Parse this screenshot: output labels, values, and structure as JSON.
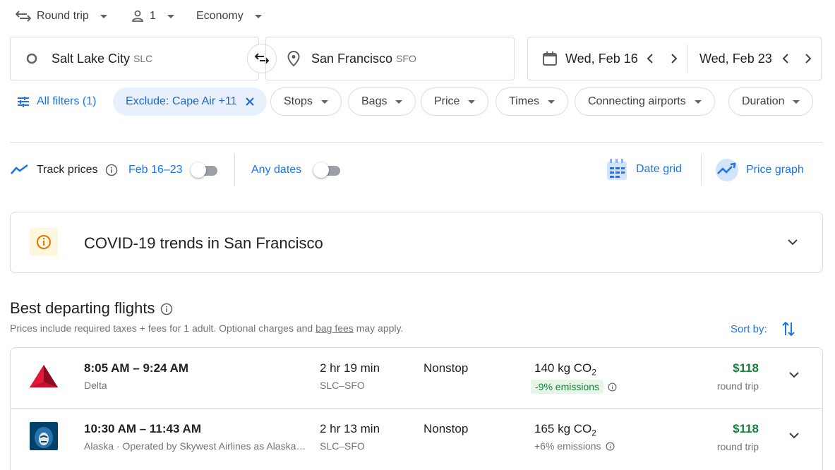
{
  "trip": {
    "type": "Round trip",
    "passengers": "1",
    "cabin": "Economy"
  },
  "search": {
    "origin_city": "Salt Lake City",
    "origin_code": "SLC",
    "dest_city": "San Francisco",
    "dest_code": "SFO",
    "depart_date": "Wed, Feb 16",
    "return_date": "Wed, Feb 23"
  },
  "filters": {
    "all": "All filters (1)",
    "exclude": "Exclude: Cape Air +11",
    "chips": [
      "Stops",
      "Bags",
      "Price",
      "Times",
      "Connecting airports",
      "Duration"
    ]
  },
  "tracking": {
    "track_label": "Track prices",
    "range": "Feb 16–23",
    "any_dates": "Any dates",
    "date_grid": "Date grid",
    "price_graph": "Price graph"
  },
  "covid": {
    "title": "COVID-19 trends in San Francisco"
  },
  "results": {
    "heading": "Best departing flights",
    "note_prefix": "Prices include required taxes + fees for 1 adult. Optional charges and ",
    "note_link": "bag fees",
    "note_suffix": " may apply.",
    "sort_label": "Sort by:"
  },
  "flights": [
    {
      "times": "8:05 AM – 9:24 AM",
      "airline": "Delta",
      "duration": "2 hr 19 min",
      "route": "SLC–SFO",
      "stops": "Nonstop",
      "co2": "140 kg CO",
      "co2_sub": "2",
      "emissions": "-9% emissions",
      "price": "$118",
      "price_type": "round trip"
    },
    {
      "times": "10:30 AM – 11:43 AM",
      "airline": "Alaska · Operated by Skywest Airlines as AlaskaSkywest",
      "duration": "2 hr 13 min",
      "route": "SLC–SFO",
      "stops": "Nonstop",
      "co2": "165 kg CO",
      "co2_sub": "2",
      "emissions": "+6% emissions",
      "price": "$118",
      "price_type": "round trip"
    }
  ],
  "colors": {
    "accent": "#1a73e8",
    "price": "#188038",
    "chip_active": "#e8f0fe"
  }
}
